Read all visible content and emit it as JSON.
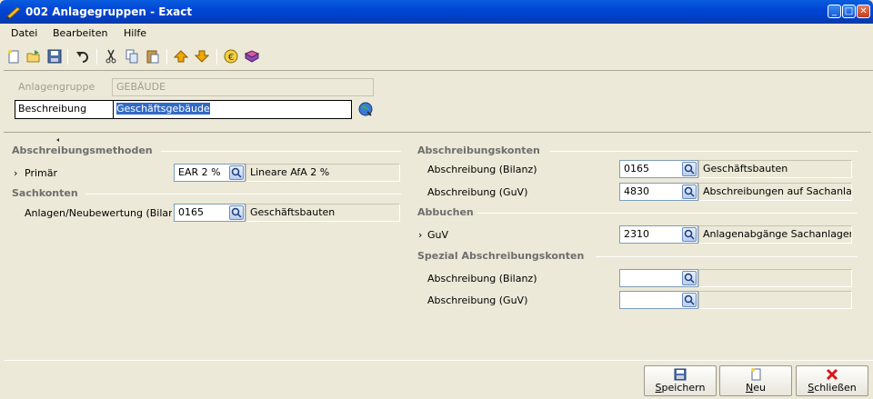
{
  "window": {
    "title": "002 Anlagegruppen - Exact"
  },
  "menu": {
    "items": [
      "Datei",
      "Bearbeiten",
      "Hilfe"
    ]
  },
  "header": {
    "anlagengruppe_label": "Anlagengruppe",
    "anlagengruppe_value": "GEBÄUDE",
    "beschreibung_label": "Beschreibung",
    "beschreibung_value": "Geschäftsgebäude"
  },
  "left": {
    "abschreibungsmethoden_title": "Abschreibungsmethoden",
    "primaer_label": "Primär",
    "primaer_code": "EAR 2 %",
    "primaer_desc": "Lineare AfA 2 %",
    "sachkonten_title": "Sachkonten",
    "anlagen_label": "Anlagen/Neubewertung (Bilanz)",
    "anlagen_code": "0165",
    "anlagen_desc": "Geschäftsbauten"
  },
  "right": {
    "abschreibungskonten_title": "Abschreibungskonten",
    "bilanz_label": "Abschreibung (Bilanz)",
    "bilanz_code": "0165",
    "bilanz_desc": "Geschäftsbauten",
    "guv_label": "Abschreibung (GuV)",
    "guv_code": "4830",
    "guv_desc": "Abschreibungen auf Sachanlagen",
    "abbuchen_title": "Abbuchen",
    "abbuchen_guv_label": "GuV",
    "abbuchen_guv_code": "2310",
    "abbuchen_guv_desc": "Anlagenabgänge Sachanlagen",
    "spezial_title": "Spezial Abschreibungskonten",
    "spezial_bilanz_label": "Abschreibung (Bilanz)",
    "spezial_bilanz_code": "",
    "spezial_bilanz_desc": "",
    "spezial_guv_label": "Abschreibung (GuV)",
    "spezial_guv_code": "",
    "spezial_guv_desc": ""
  },
  "footer": {
    "save_first": "S",
    "save_rest": "peichern",
    "new_first": "N",
    "new_rest": "eu",
    "close_first": "S",
    "close_rest": "chließen"
  },
  "colors": {
    "titlebar": "#0046d5",
    "selection": "#316ac5",
    "background": "#ece9d8"
  }
}
